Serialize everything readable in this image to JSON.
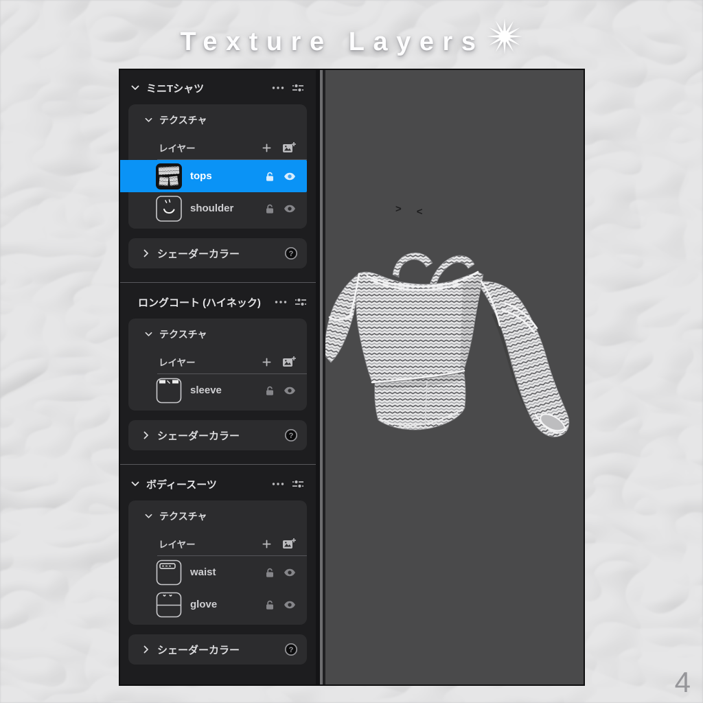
{
  "title": {
    "text": "Texture Layers"
  },
  "page_number": "4",
  "icons": {
    "starburst": "✴",
    "chevron_down": "⌄",
    "chevron_right": "›",
    "more_options": "…",
    "adjust_sliders": "sliders",
    "add_layer": "+",
    "add_image": "image-plus",
    "unlocked": "open-padlock",
    "visible": "eye",
    "help": "?"
  },
  "viewport": {
    "camera_arrows": {
      "left": ">",
      "right": "<"
    }
  },
  "panel": {
    "sections": [
      {
        "header": "ミニTシャツ",
        "texture": {
          "label": "テクスチャ",
          "layers_header": "レイヤー",
          "layers": [
            {
              "name": "tops",
              "selected": true,
              "locked": false,
              "visible": true
            },
            {
              "name": "shoulder",
              "selected": false,
              "locked": false,
              "visible": true
            }
          ]
        },
        "shader": {
          "label": "シェーダーカラー"
        }
      },
      {
        "header": "ロングコート (ハイネック)",
        "texture": {
          "label": "テクスチャ",
          "layers_header": "レイヤー",
          "layers": [
            {
              "name": "sleeve",
              "selected": false,
              "locked": false,
              "visible": true
            }
          ]
        },
        "shader": {
          "label": "シェーダーカラー"
        }
      },
      {
        "header": "ボディースーツ",
        "texture": {
          "label": "テクスチャ",
          "layers_header": "レイヤー",
          "layers": [
            {
              "name": "waist",
              "selected": false,
              "locked": false,
              "visible": true
            },
            {
              "name": "glove",
              "selected": false,
              "locked": false,
              "visible": true
            }
          ]
        },
        "shader": {
          "label": "シェーダーカラー"
        }
      }
    ]
  },
  "colors": {
    "selection_blue": "#0a93f6",
    "panel_bg": "#1d1d1f",
    "card_bg": "#2c2c2e",
    "viewport_bg": "#4a4a4b",
    "background_gray": "#c6c7c9",
    "title_white": "#fdfdfe"
  }
}
